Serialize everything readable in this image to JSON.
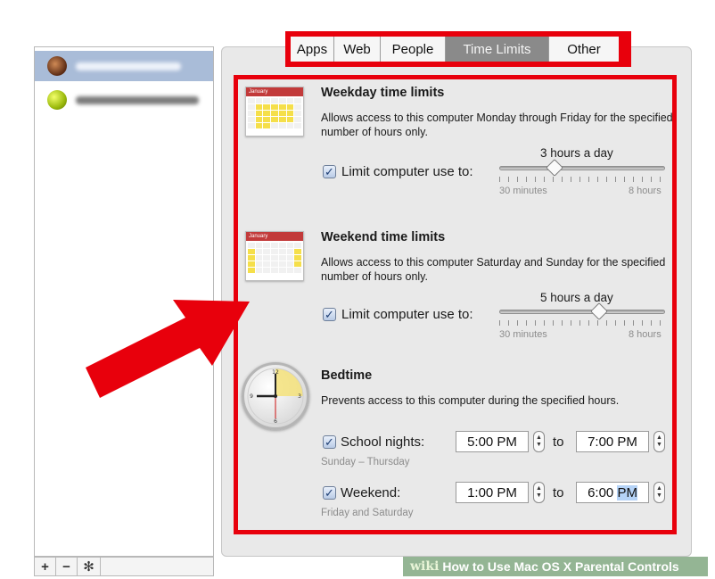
{
  "tabs": [
    {
      "label": "Apps"
    },
    {
      "label": "Web"
    },
    {
      "label": "People"
    },
    {
      "label": "Time Limits"
    },
    {
      "label": "Other"
    }
  ],
  "sidebar": {
    "toolbar": {
      "add": "+",
      "remove": "−",
      "settings": "✻"
    }
  },
  "weekday": {
    "title": "Weekday time limits",
    "description": "Allows access to this computer Monday through Friday for the specified number of hours only.",
    "checkbox_label": "Limit computer use to:",
    "checked": true,
    "value_label": "3 hours a day",
    "hours": 3,
    "min_label": "30 minutes",
    "max_label": "8 hours"
  },
  "weekend": {
    "title": "Weekend time limits",
    "description": "Allows access to this computer Saturday and Sunday for the specified number of hours only.",
    "checkbox_label": "Limit computer use to:",
    "checked": true,
    "value_label": "5 hours a day",
    "hours": 5,
    "min_label": "30 minutes",
    "max_label": "8 hours"
  },
  "bedtime": {
    "title": "Bedtime",
    "description": "Prevents access to this computer during the specified hours.",
    "school": {
      "label": "School nights:",
      "sublabel": "Sunday – Thursday",
      "from": "5:00 PM",
      "to_word": "to",
      "to": "7:00 PM",
      "checked": true
    },
    "weekend": {
      "label": "Weekend:",
      "sublabel": "Friday and Saturday",
      "from": "1:00 PM",
      "to_word": "to",
      "to_time": "6:00",
      "to_ampm": "PM",
      "checked": true
    }
  },
  "calendar_icon": {
    "month": "January"
  },
  "watermark": {
    "brand": "wiki",
    "text": "How to Use Mac OS X Parental Controls"
  },
  "colors": {
    "highlight_red": "#e8000c",
    "selected_tab": "#8a8a8a",
    "selection": "#a9bcd8"
  }
}
